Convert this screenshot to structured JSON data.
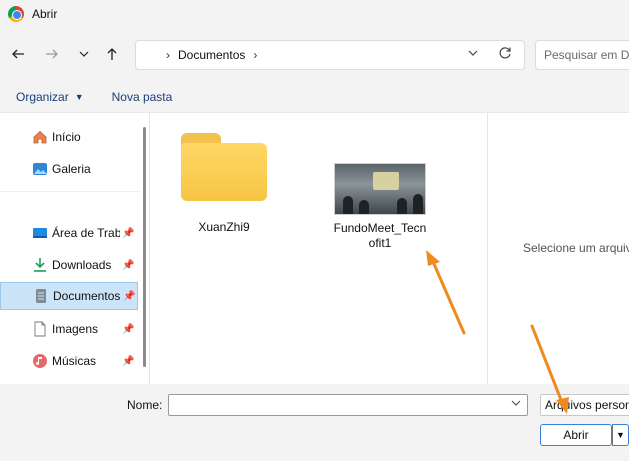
{
  "window": {
    "title": "Abrir",
    "icon": "chrome-icon"
  },
  "nav": {
    "back_icon": "arrow-left-icon",
    "forward_icon": "arrow-right-icon",
    "recent_icon": "chevron-down-icon",
    "up_icon": "arrow-up-icon",
    "breadcrumb": [
      "Documentos"
    ],
    "search_placeholder": "Pesquisar em Do"
  },
  "toolbar": {
    "organize_label": "Organizar",
    "new_folder_label": "Nova pasta"
  },
  "sidebar": {
    "items": [
      {
        "label": "Início",
        "icon": "home-icon"
      },
      {
        "label": "Galeria",
        "icon": "gallery-icon"
      },
      {
        "label": "Área de Trabalho",
        "icon": "desktop-icon",
        "pinned": true
      },
      {
        "label": "Downloads",
        "icon": "download-icon",
        "pinned": true
      },
      {
        "label": "Documentos",
        "icon": "documents-icon",
        "pinned": true,
        "selected": true
      },
      {
        "label": "Imagens",
        "icon": "images-icon",
        "pinned": true
      },
      {
        "label": "Músicas",
        "icon": "music-icon",
        "pinned": true
      }
    ]
  },
  "files": [
    {
      "label": "XuanZhi9",
      "type": "folder",
      "icon": "folder-icon"
    },
    {
      "label_line1": "FundoMeet_Tecn",
      "label_line2": "ofit1",
      "type": "image",
      "icon": "image-thumbnail"
    }
  ],
  "preview": {
    "text": "Selecione um arquivo"
  },
  "footer": {
    "name_label": "Nome:",
    "name_value": "",
    "file_type_value": "Arquivos personalizados",
    "open_label": "Abrir"
  },
  "colors": {
    "accent": "#3c7fd6",
    "selected_bg": "#cce4f7",
    "annotation_arrow": "#f0891e",
    "folder": "#f7c543"
  }
}
